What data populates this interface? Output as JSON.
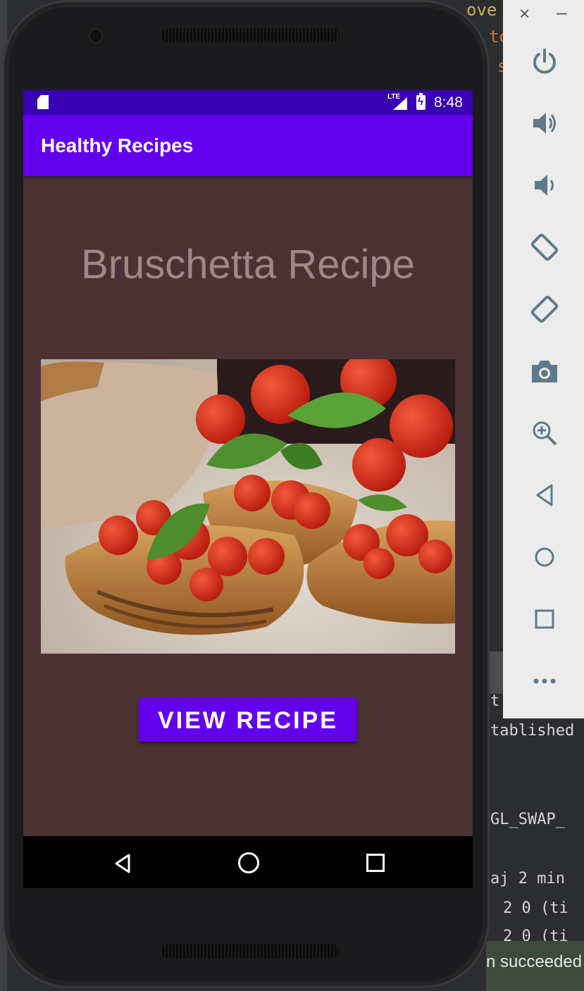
{
  "ide_background": {
    "top_fragments": [
      "ove",
      "to",
      "s"
    ],
    "lines": [
      "t",
      "tablished",
      "GL_SWAP_",
      "aj 2 min",
      "2 0 (ti",
      "2 0 (ti"
    ],
    "status_text": "n succeeded"
  },
  "status_bar": {
    "network": "LTE",
    "time": "8:48"
  },
  "app_bar": {
    "title": "Healthy Recipes"
  },
  "main": {
    "recipe_title": "Bruschetta Recipe",
    "button_label": "VIEW RECIPE"
  },
  "emulator_panel": {
    "window_close": "×",
    "window_minimize": "–",
    "buttons": [
      "power",
      "volume-up",
      "volume-down",
      "rotate-left",
      "rotate-right",
      "screenshot",
      "zoom",
      "back",
      "home",
      "overview",
      "more"
    ]
  },
  "colors": {
    "status_bar": "#3700b3",
    "app_bar": "#6200ee",
    "screen_background": "#4a3234",
    "title_text": "#9e8882",
    "button": "#6200ee"
  }
}
